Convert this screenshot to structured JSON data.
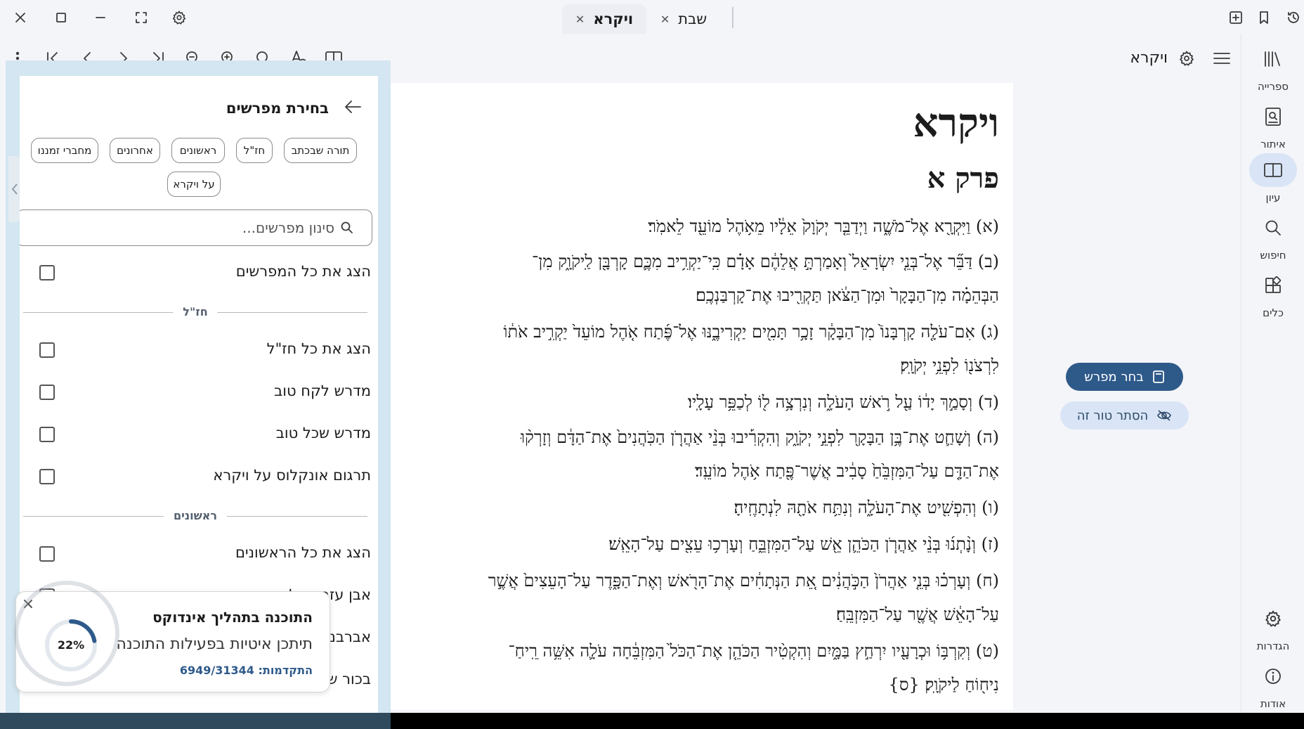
{
  "tabs": [
    {
      "label": "ויקרא",
      "active": true
    },
    {
      "label": "שבת",
      "active": false
    }
  ],
  "header": {
    "book_title": "ויקרא"
  },
  "rail": [
    {
      "label": "ספרייה",
      "icon": "library-icon"
    },
    {
      "label": "איתור",
      "icon": "locate-icon"
    },
    {
      "label": "עיון",
      "icon": "book-open-icon",
      "active": true
    },
    {
      "label": "חיפוש",
      "icon": "search-icon"
    },
    {
      "label": "כלים",
      "icon": "tools-icon"
    },
    {
      "label": "הגדרות",
      "icon": "settings-icon"
    },
    {
      "label": "אודות",
      "icon": "info-icon"
    }
  ],
  "content": {
    "title": "ויקרא",
    "chapter": "פרק א",
    "verses": [
      "(א) וַיִּקְרָ֖א אֶל־מֹשֶׁ֑ה וַיְדַבֵּ֤ר יְקֹוָק֙ אֵלָ֔יו מֵאֹ֥הֶל מוֹעֵ֖ד לֵאמֹֽר׃",
      "(ב) דַּבֵּ֞ר אֶל־בְּנֵ֤י יִשְׂרָאֵל֙ וְאָמַרְתָּ֣ אֲלֵהֶ֔ם אָדָ֗ם כִּֽי־יַקְרִ֥יב מִכֶּ֛ם קָרְבָּ֖ן לַֽיקֹוָ֑ק מִן־",
      "הַבְּהֵמָ֗ה מִן־הַבָּקָר֙ וּמִן־הַצֹּ֔אן תַּקְרִ֖יבוּ אֶת־קָרְבַּנְכֶֽם׃",
      "(ג) אִם־עֹלָ֤ה קָרְבָּנוֹ֙ מִן־הַבָּקָ֔ר זָכָ֥ר תָּמִ֖ים יַקְרִיבֶ֑נּוּ אֶל־פֶּ֜תַח אֹ֤הֶל מוֹעֵד֙ יַקְרִ֣יב אֹת֔וֹ",
      "לִרְצֹנ֖וֹ לִפְנֵ֥י יְקֹוָֽק׃",
      "(ד) וְסָמַ֣ךְ יָד֔וֹ עַ֖ל רֹ֣אשׁ הָעֹלָ֑ה וְנִרְצָ֥ה ל֖וֹ לְכַפֵּ֥ר עָלָֽיו׃",
      "(ה) וְשָׁחַ֛ט אֶת־בֶּ֥ן הַבָּקָ֖ר לִפְנֵ֣י יְקֹוָ֑ק וְהִקְרִ֡יבוּ בְּנֵ֨י אַהֲרֹ֤ן הַכֹּֽהֲנִים֙ אֶת־הַדָּ֔ם וְזָרְק֨וּ",
      "אֶת־הַדָּ֤ם עַל־הַמִּזְבֵּ֙חַ֙ סָבִ֔יב אֲשֶׁר־פֶּ֖תַח אֹ֥הֶל מוֹעֵֽד׃",
      "(ו) וְהִפְשִׁ֖יט אֶת־הָעֹלָ֑ה וְנִתַּ֥ח אֹתָ֖הּ לִנְתָחֶֽיהָ׃",
      "(ז) וְנָ֨תְנ֜וּ בְּנֵ֨י אַהֲרֹ֧ן הַכֹּהֵ֛ן אֵ֖שׁ עַל־הַמִּזְבֵּ֑חַ וְעָרְכ֥וּ עֵצִ֖ים עַל־הָאֵֽשׁ׃",
      "(ח) וְעָרְכ֗וּ בְּנֵ֤י אַהֲרֹן֙ הַכֹּ֣הֲנִ֔ים אֵ֚ת הַנְּתָחִ֔ים אֶת־הָרֹ֖אשׁ וְאֶת־הַפָּ֑דֶר עַל־הָעֵצִים֙ אֲשֶׁ֣ר",
      "עַל־הָאֵ֔שׁ אֲשֶׁ֖ר עַל־הַמִּזְבֵּֽחַ׃",
      "(ט) וְקִרְבּ֥וֹ וּכְרָעָ֖יו יִרְחַ֣ץ בַּמָּ֑יִם וְהִקְטִ֨יר הַכֹּהֵ֤ן אֶת־הַכֹּל֙ הַמִּזְבֵּ֔חָה עֹלָ֛ה אִשֵּׁ֥ה רֵֽיחַ־",
      "נִיח֖וֹחַ לַיקֹוָֽק׃ {ס}"
    ]
  },
  "actions": {
    "choose_commentator": "בחר מפרש",
    "hide_column": "הסתר טור זה"
  },
  "panel": {
    "heading": "בחירת מפרשים",
    "filter_chips": [
      "תורה שבכתב",
      "חז\"ל",
      "ראשונים",
      "אחרונים",
      "מחברי זמננו",
      "על ויקרא"
    ],
    "search_placeholder": "סינון מפרשים...",
    "show_all": "הצג את כל המפרשים",
    "groups": [
      {
        "title": "חז\"ל",
        "items": [
          "הצג את כל חז\"ל",
          "מדרש לקח טוב",
          "מדרש שכל טוב",
          "תרגום אונקלוס על ויקרא"
        ]
      },
      {
        "title": "ראשונים",
        "items": [
          "הצג את כל הראשונים",
          "אבן עזרא על ויקרא",
          "אברבנאל על ויקרא",
          "בכור שור"
        ]
      }
    ]
  },
  "toast": {
    "title": "התוכנה בתהליך אינדוקס",
    "message": "תיתכן איטיות בפעילות התוכנה",
    "progress_label": "התקדמות:",
    "progress_value": "6949/31344",
    "percent_label": "22%",
    "percent_fraction": 0.22
  },
  "colors": {
    "accent": "#2e5a8a",
    "accent_light": "#d9e5f6",
    "panel_frame": "#d3e6f1"
  }
}
